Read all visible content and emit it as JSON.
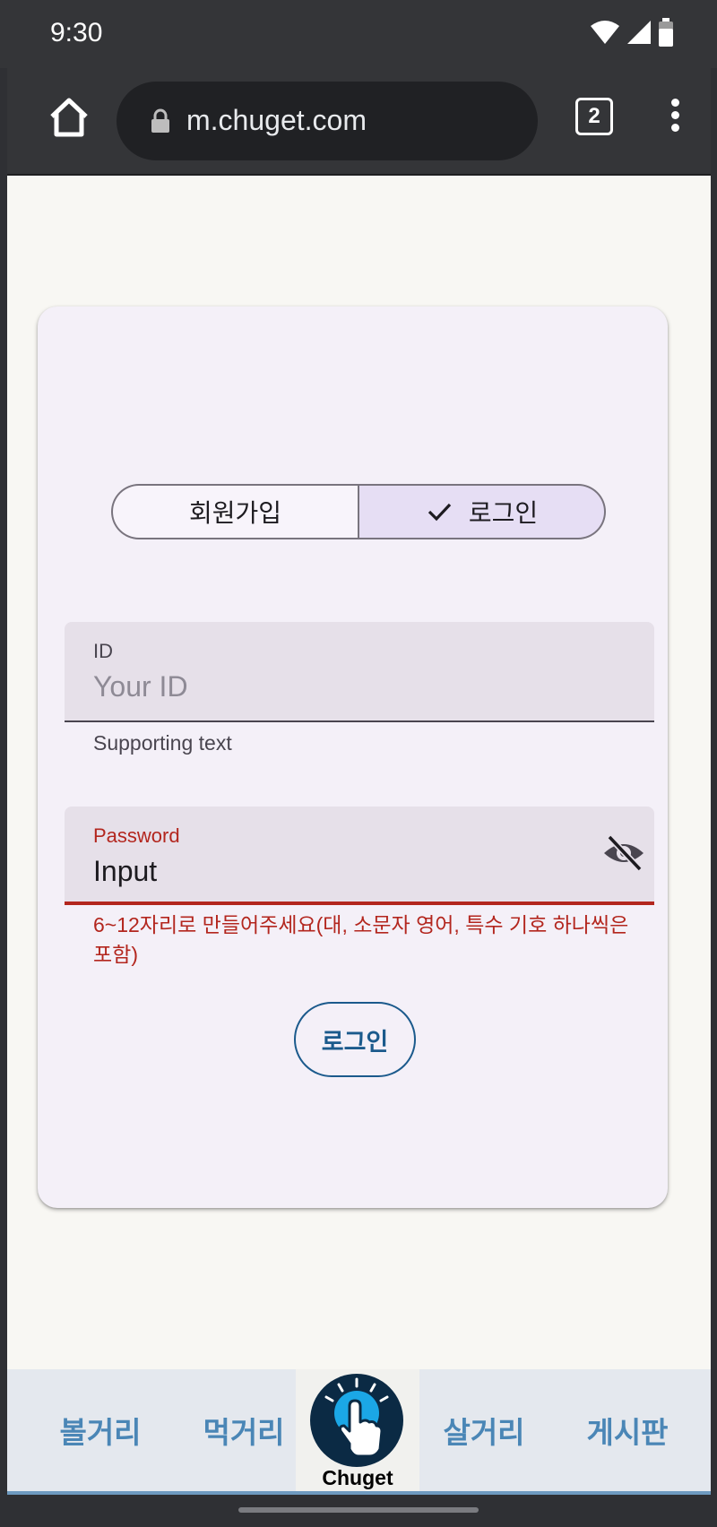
{
  "status_bar": {
    "time": "9:30"
  },
  "browser": {
    "url": "m.chuget.com",
    "tab_count": "2"
  },
  "segmented": {
    "signup_label": "회원가입",
    "login_label": "로그인",
    "selected": "login"
  },
  "id_field": {
    "label": "ID",
    "placeholder": "Your ID",
    "value": "",
    "supporting_text": "Supporting text"
  },
  "password_field": {
    "label": "Password",
    "value": "Input",
    "error_text": "6~12자리로 만들어주세요(대, 소문자 영어, 특수 기호 하나씩은 포함)"
  },
  "login_button": {
    "label": "로그인"
  },
  "bottom_nav": {
    "items": [
      {
        "label": "볼거리"
      },
      {
        "label": "먹거리"
      },
      {
        "label": "살거리"
      },
      {
        "label": "게시판"
      }
    ],
    "logo_text": "Chuget"
  },
  "colors": {
    "error": "#b3261e",
    "brand_blue": "#1b5a8c",
    "nav_label": "#4a86b6",
    "segment_selected": "#e6def4",
    "logo_accent": "#1ba7e6"
  }
}
